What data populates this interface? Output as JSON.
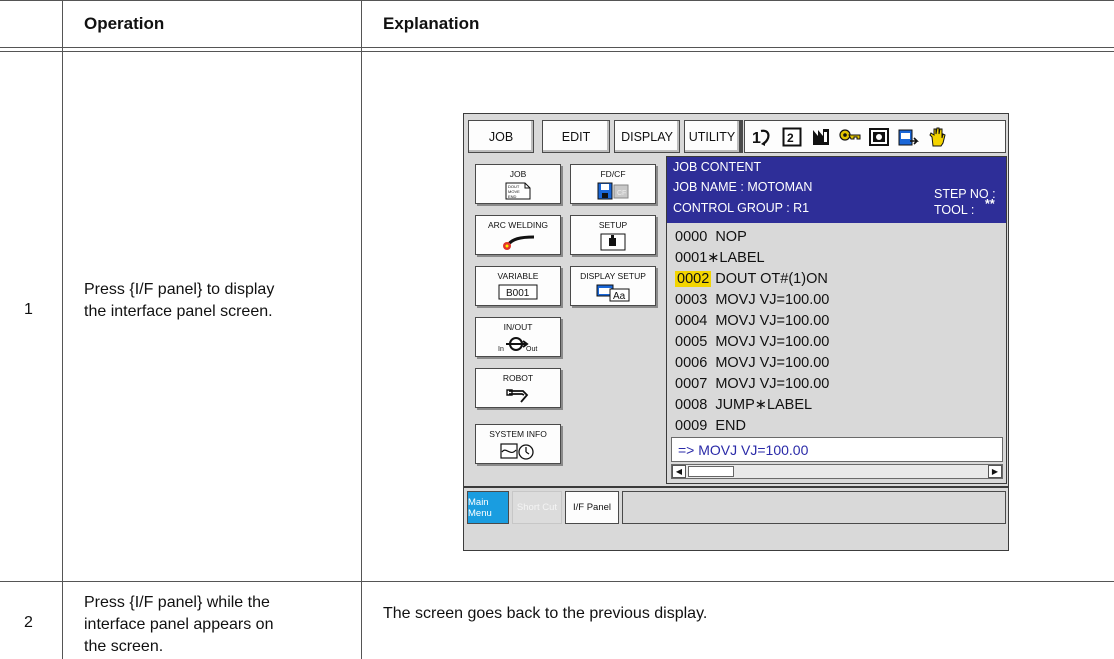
{
  "table": {
    "headers": {
      "operation": "Operation",
      "explanation": "Explanation"
    },
    "rows": [
      {
        "num": "1",
        "operation": [
          "Press {I/F panel} to display",
          "the interface panel screen."
        ]
      },
      {
        "num": "2",
        "operation": [
          "Press {I/F panel} while the",
          "interface panel appears on",
          "the screen."
        ],
        "explanation": "The screen goes back to the previous display."
      }
    ]
  },
  "screen": {
    "top_menu": [
      "JOB",
      "EDIT",
      "DISPLAY",
      "UTILITY"
    ],
    "status_icons": [
      "coordinate-icon",
      "mode-icon",
      "job-icon",
      "key-icon",
      "memory-icon",
      "teach-icon",
      "hand-icon"
    ],
    "main_menu": {
      "job": {
        "label": "JOB",
        "icon_lines": [
          "DOUT",
          "MOVE",
          "END"
        ]
      },
      "fd_cf": {
        "label": "FD/CF",
        "icon_text": "CF"
      },
      "arc_welding": {
        "label": "ARC WELDING"
      },
      "setup": {
        "label": "SETUP"
      },
      "variable": {
        "label": "VARIABLE",
        "icon_text": "B001"
      },
      "display_setup": {
        "label": "DISPLAY SETUP",
        "icon_text": "Aa"
      },
      "in_out": {
        "label": "IN/OUT",
        "icon_in": "In",
        "icon_out": "Out"
      },
      "robot": {
        "label": "ROBOT"
      },
      "system_info": {
        "label": "SYSTEM INFO"
      }
    },
    "job_content": {
      "title": "JOB CONTENT",
      "job_name": "JOB NAME : MOTOMAN",
      "control_group": "CONTROL GROUP : R1",
      "step_no": "STEP NO :",
      "tool": "TOOL :",
      "tool_value": "**",
      "lines": [
        {
          "no": "0000",
          "text": "NOP"
        },
        {
          "no": "0001",
          "text": "∗LABEL"
        },
        {
          "no": "0002",
          "text": "DOUT OT#(1)ON"
        },
        {
          "no": "0003",
          "text": "MOVJ VJ=100.00"
        },
        {
          "no": "0004",
          "text": "MOVJ VJ=100.00"
        },
        {
          "no": "0005",
          "text": "MOVJ VJ=100.00"
        },
        {
          "no": "0006",
          "text": "MOVJ VJ=100.00"
        },
        {
          "no": "0007",
          "text": "MOVJ VJ=100.00"
        },
        {
          "no": "0008",
          "text": "JUMP∗LABEL"
        },
        {
          "no": "0009",
          "text": "END"
        }
      ],
      "highlighted_line": "0002",
      "command_line": "=> MOVJ VJ=100.00"
    },
    "bottom": {
      "main_menu": "Main Menu",
      "short_cut": "Short Cut",
      "if_panel": "I/F Panel"
    },
    "colors": {
      "title_bar": "#2e2e98",
      "highlight": "#f3d500",
      "main_menu_button": "#1a9de0",
      "command_text": "#2a2aa8"
    }
  }
}
